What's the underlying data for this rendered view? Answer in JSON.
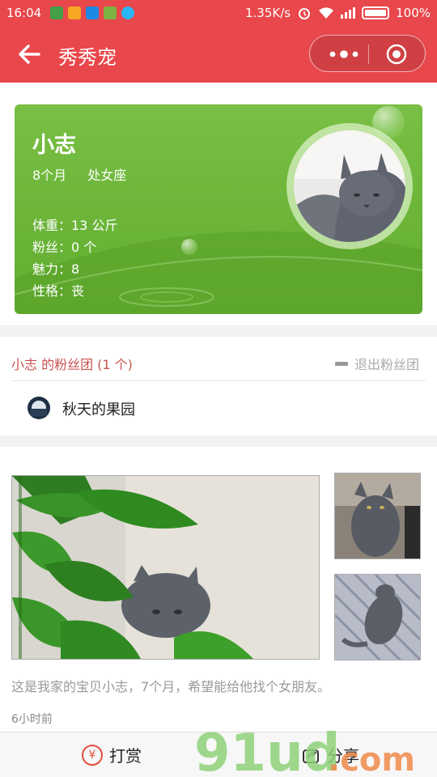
{
  "status_bar": {
    "time": "16:04",
    "network_speed": "1.35K/s",
    "battery": "100%",
    "icons": [
      "shield-icon",
      "notification-icon",
      "upload-icon",
      "battery-saver-icon",
      "clock-icon",
      "alarm-icon",
      "wifi-icon",
      "signal-icon",
      "battery-icon"
    ]
  },
  "nav": {
    "title": "秀秀宠",
    "back_icon": "arrow-left-icon",
    "menu_icon": "more-dots-icon",
    "close_icon": "target-circle-icon",
    "color": "#e8474b"
  },
  "profile": {
    "name": "小志",
    "age": "8个月",
    "zodiac": "处女座",
    "stats": [
      "体重：13 公斤",
      "粉丝：0 个",
      "魅力：8",
      "性格：丧"
    ],
    "card_color": "#6cb53a"
  },
  "fans": {
    "title": "小志 的粉丝团  (1 个)",
    "quit_label": "退出粉丝团",
    "members": [
      {
        "name": "秋天的果园"
      }
    ]
  },
  "post": {
    "text": "这是我家的宝贝小志，7个月，希望能给他找个女朋友。",
    "time": "6小时前"
  },
  "bottom_bar": {
    "reward_label": "打赏",
    "share_label": "分享",
    "reward_icon": "yen-coin-icon",
    "share_icon": "share-icon"
  },
  "watermark": "91ud.com"
}
